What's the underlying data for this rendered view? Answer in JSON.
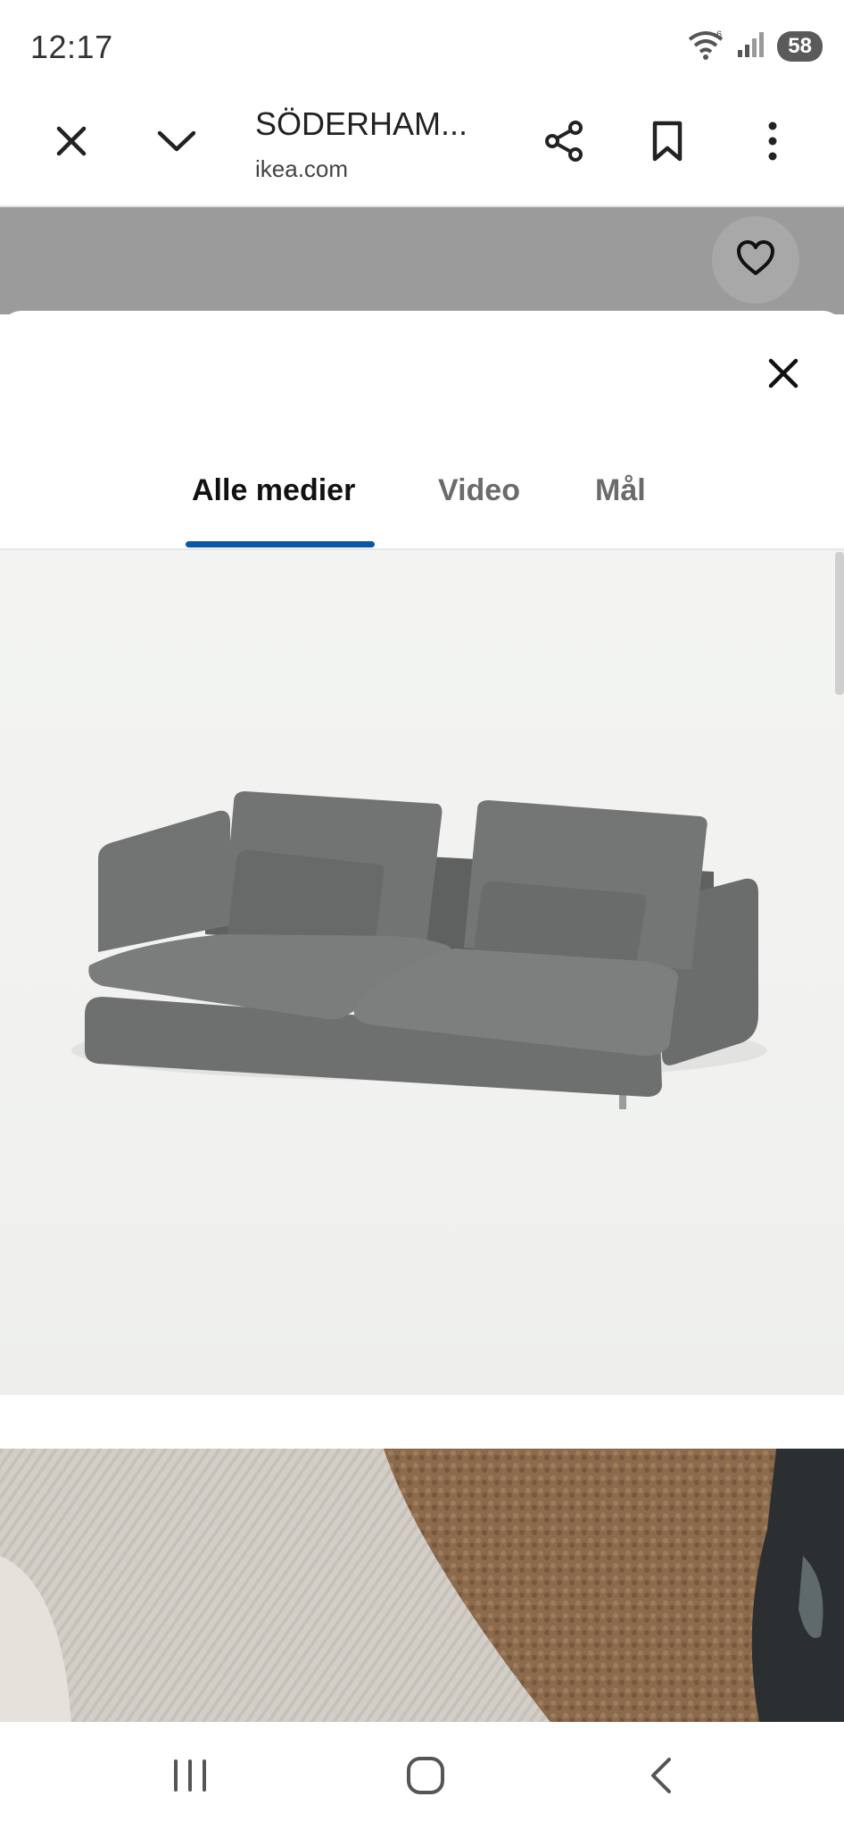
{
  "status_bar": {
    "time": "12:17",
    "battery": "58",
    "icons": [
      "wifi-icon",
      "signal-icon",
      "battery-icon"
    ]
  },
  "browser": {
    "title": "SÖDERHAM...",
    "url": "ikea.com",
    "icons": [
      "close-icon",
      "chevron-down-icon",
      "share-icon",
      "bookmark-icon",
      "more-vertical-icon"
    ]
  },
  "page": {
    "favorite_icon": "heart-icon"
  },
  "media_viewer": {
    "close_icon": "close-icon",
    "tabs": [
      {
        "label": "Alle medier",
        "active": true
      },
      {
        "label": "Video",
        "active": false
      },
      {
        "label": "Mål",
        "active": false
      }
    ],
    "items": [
      {
        "type": "image",
        "subject": "sofa"
      },
      {
        "type": "image",
        "subject": "fabric-and-rug"
      }
    ]
  },
  "nav_bar": {
    "icons": [
      "recent-apps-icon",
      "home-icon",
      "back-icon"
    ]
  },
  "colors": {
    "accent": "#0a58a5",
    "dim_overlay": "#9b9b9b",
    "sofa": "#6d6f6e"
  }
}
